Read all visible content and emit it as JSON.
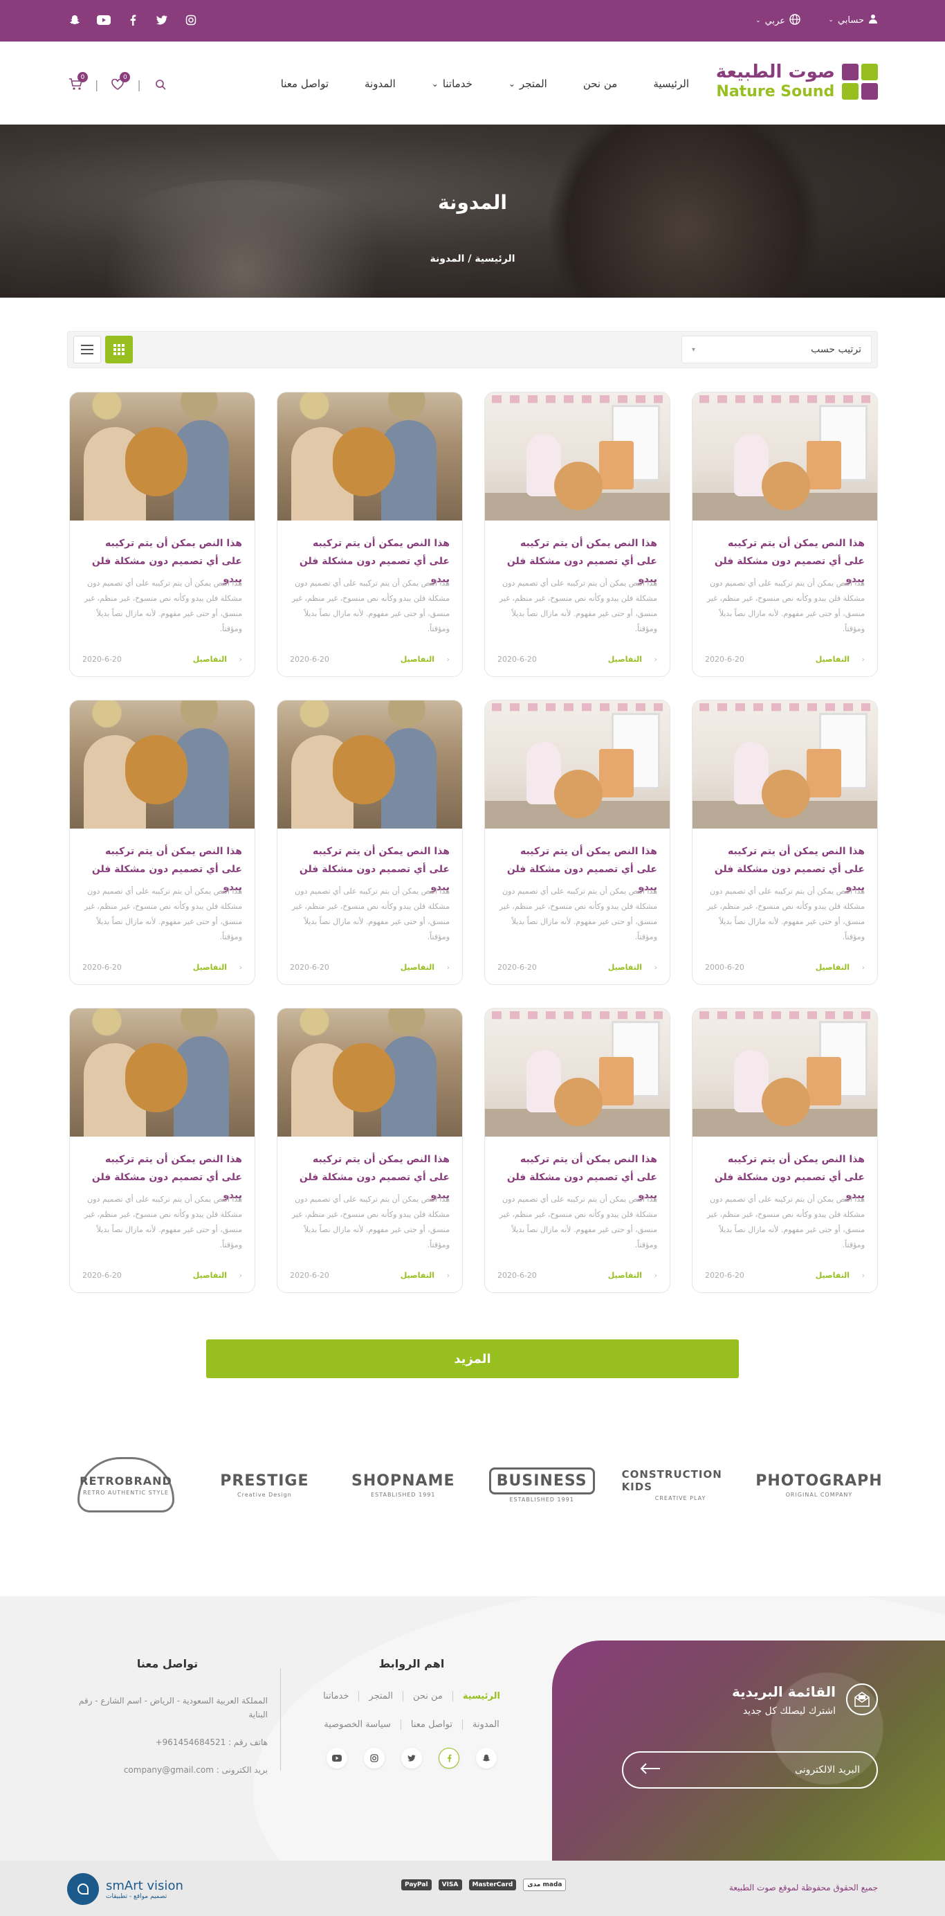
{
  "topbar": {
    "account_label": "حسابي",
    "language_label": "عربي",
    "social": [
      "instagram-icon",
      "twitter-icon",
      "facebook-icon",
      "youtube-icon",
      "snapchat-icon"
    ]
  },
  "logo": {
    "ar": "صوت الطبيعة",
    "en": "Nature Sound"
  },
  "nav": {
    "items": [
      {
        "label": "الرئيسية"
      },
      {
        "label": "من نحن"
      },
      {
        "label": "المتجر"
      },
      {
        "label": "خدماتنا"
      },
      {
        "label": "المدونة"
      },
      {
        "label": "تواصل معنا"
      }
    ],
    "cart_count": "0",
    "wishlist_count": "0"
  },
  "banner": {
    "title": "المدونة",
    "breadcrumb": "الرئيسية / المدونة"
  },
  "toolbar": {
    "sort_label": "ترتيب حسب"
  },
  "cards": [
    {
      "img": "kid",
      "title": "هذا النص يمكن أن يتم تركيبه على أي تصميم دون مشكلة فلن يبدو",
      "excerpt": "هذا النص يمكن أن يتم تركيبه على أي تصميم دون مشكلة فلن يبدو وكأنه نص منسوخ، غير منظم، غير منسق، أو حتى غير مفهوم. لأنه مازال نصاً بديلاً ومؤقتاً.",
      "more": "التفاصيل",
      "date": "2020-6-20"
    },
    {
      "img": "kid",
      "title": "هذا النص يمكن أن يتم تركيبه على أي تصميم دون مشكلة فلن يبدو",
      "excerpt": "هذا النص يمكن أن يتم تركيبه على أي تصميم دون مشكلة فلن يبدو وكأنه نص منسوخ، غير منظم، غير منسق، أو حتى غير مفهوم. لأنه مازال نصاً بديلاً ومؤقتاً.",
      "more": "التفاصيل",
      "date": "2020-6-20"
    },
    {
      "img": "couple",
      "title": "هذا النص يمكن أن يتم تركيبه على أي تصميم دون مشكلة فلن يبدو",
      "excerpt": "هذا النص يمكن أن يتم تركيبه على أي تصميم دون مشكلة فلن يبدو وكأنه نص منسوخ، غير منظم، غير منسق، أو حتى غير مفهوم. لأنه مازال نصاً بديلاً ومؤقتاً.",
      "more": "التفاصيل",
      "date": "2020-6-20"
    },
    {
      "img": "couple",
      "title": "هذا النص يمكن أن يتم تركيبه على أي تصميم دون مشكلة فلن يبدو",
      "excerpt": "هذا النص يمكن أن يتم تركيبه على أي تصميم دون مشكلة فلن يبدو وكأنه نص منسوخ، غير منظم، غير منسق، أو حتى غير مفهوم. لأنه مازال نصاً بديلاً ومؤقتاً.",
      "more": "التفاصيل",
      "date": "2020-6-20"
    },
    {
      "img": "kid",
      "title": "هذا النص يمكن أن يتم تركيبه على أي تصميم دون مشكلة فلن يبدو",
      "excerpt": "هذا النص يمكن أن يتم تركيبه على أي تصميم دون مشكلة فلن يبدو وكأنه نص منسوخ، غير منظم، غير منسق، أو حتى غير مفهوم. لأنه مازال نصاً بديلاً ومؤقتاً.",
      "more": "التفاصيل",
      "date": "2000-6-20"
    },
    {
      "img": "kid",
      "title": "هذا النص يمكن أن يتم تركيبه على أي تصميم دون مشكلة فلن يبدو",
      "excerpt": "هذا النص يمكن أن يتم تركيبه على أي تصميم دون مشكلة فلن يبدو وكأنه نص منسوخ، غير منظم، غير منسق، أو حتى غير مفهوم. لأنه مازال نصاً بديلاً ومؤقتاً.",
      "more": "التفاصيل",
      "date": "2020-6-20"
    },
    {
      "img": "couple",
      "title": "هذا النص يمكن أن يتم تركيبه على أي تصميم دون مشكلة فلن يبدو",
      "excerpt": "هذا النص يمكن أن يتم تركيبه على أي تصميم دون مشكلة فلن يبدو وكأنه نص منسوخ، غير منظم، غير منسق، أو حتى غير مفهوم. لأنه مازال نصاً بديلاً ومؤقتاً.",
      "more": "التفاصيل",
      "date": "2020-6-20"
    },
    {
      "img": "couple",
      "title": "هذا النص يمكن أن يتم تركيبه على أي تصميم دون مشكلة فلن يبدو",
      "excerpt": "هذا النص يمكن أن يتم تركيبه على أي تصميم دون مشكلة فلن يبدو وكأنه نص منسوخ، غير منظم، غير منسق، أو حتى غير مفهوم. لأنه مازال نصاً بديلاً ومؤقتاً.",
      "more": "التفاصيل",
      "date": "2020-6-20"
    },
    {
      "img": "kid",
      "title": "هذا النص يمكن أن يتم تركيبه على أي تصميم دون مشكلة فلن يبدو",
      "excerpt": "هذا النص يمكن أن يتم تركيبه على أي تصميم دون مشكلة فلن يبدو وكأنه نص منسوخ، غير منظم، غير منسق، أو حتى غير مفهوم. لأنه مازال نصاً بديلاً ومؤقتاً.",
      "more": "التفاصيل",
      "date": "2020-6-20"
    },
    {
      "img": "kid",
      "title": "هذا النص يمكن أن يتم تركيبه على أي تصميم دون مشكلة فلن يبدو",
      "excerpt": "هذا النص يمكن أن يتم تركيبه على أي تصميم دون مشكلة فلن يبدو وكأنه نص منسوخ، غير منظم، غير منسق، أو حتى غير مفهوم. لأنه مازال نصاً بديلاً ومؤقتاً.",
      "more": "التفاصيل",
      "date": "2020-6-20"
    },
    {
      "img": "couple",
      "title": "هذا النص يمكن أن يتم تركيبه على أي تصميم دون مشكلة فلن يبدو",
      "excerpt": "هذا النص يمكن أن يتم تركيبه على أي تصميم دون مشكلة فلن يبدو وكأنه نص منسوخ، غير منظم، غير منسق، أو حتى غير مفهوم. لأنه مازال نصاً بديلاً ومؤقتاً.",
      "more": "التفاصيل",
      "date": "2020-6-20"
    },
    {
      "img": "couple",
      "title": "هذا النص يمكن أن يتم تركيبه على أي تصميم دون مشكلة فلن يبدو",
      "excerpt": "هذا النص يمكن أن يتم تركيبه على أي تصميم دون مشكلة فلن يبدو وكأنه نص منسوخ، غير منظم، غير منسق، أو حتى غير مفهوم. لأنه مازال نصاً بديلاً ومؤقتاً.",
      "more": "التفاصيل",
      "date": "2020-6-20"
    }
  ],
  "more_button": "المزيد",
  "brands": [
    {
      "name": "RETROBRAND",
      "sub": "RETRO AUTHENTIC STYLE",
      "style": "circle"
    },
    {
      "name": "PRESTIGE",
      "sub": "Creative Design",
      "style": "plain"
    },
    {
      "name": "SHOPNAME",
      "sub": "ESTABLISHED 1991",
      "style": "plain"
    },
    {
      "name": "BUSINESS",
      "sub": "ESTABLISHED 1991",
      "style": "box"
    },
    {
      "name": "CONSTRUCTION KIDS",
      "sub": "CREATIVE PLAY",
      "style": "plain"
    },
    {
      "name": "PHOTOGRAPH",
      "sub": "ORIGINAL COMPANY",
      "style": "plain"
    }
  ],
  "newsletter": {
    "title": "القائمة البريدية",
    "subtitle": "اشترك ليصلك كل جديد",
    "placeholder": "البريد الالكترونى"
  },
  "links": {
    "title": "اهم الروابط",
    "row1": [
      "الرئيسية",
      "من نحن",
      "المتجر",
      "خدماتنا"
    ],
    "row2": [
      "المدونة",
      "تواصل معنا",
      "سياسة الخصوصية"
    ]
  },
  "contact": {
    "title": "تواصل معنا",
    "address": "المملكة العربية السعودية - الرياض - اسم الشارع - رقم البناية",
    "phone": "هاتف رقم : 961454684521+",
    "email": "بريد الكترونى : company@gmail.com"
  },
  "bottom": {
    "copyright": "جميع الحقوق محفوظة لموقع صوت الطبيعة",
    "payments": [
      "PayPal",
      "VISA",
      "MasterCard",
      "مدى mada"
    ],
    "credit": {
      "name": "smArt vision",
      "tagline": "تصميم مواقع - تطبيقات"
    }
  },
  "colors": {
    "primary": "#8a3d7c",
    "accent": "#97bf1f"
  }
}
